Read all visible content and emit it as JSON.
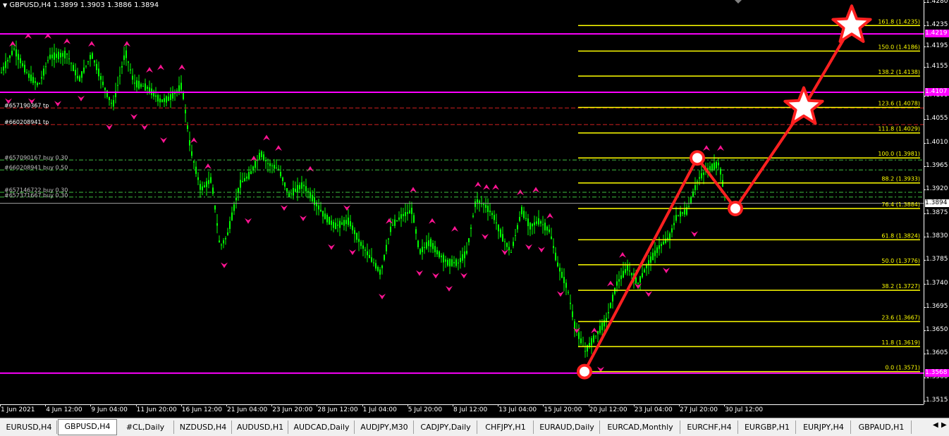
{
  "header": {
    "symbol_timeframe": "GBPUSD,H4",
    "ohlc": "1.3899 1.3903 1.3886 1.3894"
  },
  "price_axis": {
    "labels": [
      "1.4280",
      "1.4235",
      "1.4195",
      "1.4155",
      "1.4100",
      "1.4055",
      "1.4010",
      "1.3965",
      "1.3920",
      "1.3875",
      "1.3830",
      "1.3785",
      "1.3740",
      "1.3695",
      "1.3650",
      "1.3605",
      "1.3560",
      "1.3515"
    ],
    "highlights": [
      {
        "text": "1.4219",
        "color": "#ff00ff"
      },
      {
        "text": "1.4107",
        "color": "#ff00ff"
      },
      {
        "text": "1.3894",
        "color": "#ffffff"
      },
      {
        "text": "1.3568",
        "color": "#ff00ff"
      }
    ]
  },
  "time_axis": {
    "labels": [
      "1 Jun 2021",
      "4 Jun 12:00",
      "9 Jun 04:00",
      "11 Jun 20:00",
      "16 Jun 12:00",
      "21 Jun 04:00",
      "23 Jun 20:00",
      "28 Jun 12:00",
      "1 Jul 04:00",
      "5 Jul 20:00",
      "8 Jul 12:00",
      "13 Jul 04:00",
      "15 Jul 20:00",
      "20 Jul 12:00",
      "23 Jul 04:00",
      "27 Jul 20:00",
      "30 Jul 12:00"
    ]
  },
  "fib_levels": [
    {
      "label": "161.8 (1.4235)",
      "price": 1.4235
    },
    {
      "label": "150.0 (1.4186)",
      "price": 1.4186
    },
    {
      "label": "138.2 (1.4138)",
      "price": 1.4138
    },
    {
      "label": "123.6 (1.4078)",
      "price": 1.4078
    },
    {
      "label": "111.8 (1.4029)",
      "price": 1.4029
    },
    {
      "label": "100.0 (1.3981)",
      "price": 1.3981
    },
    {
      "label": "88.2 (1.3933)",
      "price": 1.3933
    },
    {
      "label": "76.4 (1.3884)",
      "price": 1.3884
    },
    {
      "label": "61.8 (1.3824)",
      "price": 1.3824
    },
    {
      "label": "50.0 (1.3776)",
      "price": 1.3776
    },
    {
      "label": "38.2 (1.3727)",
      "price": 1.3727
    },
    {
      "label": "23.6 (1.3667)",
      "price": 1.3667
    },
    {
      "label": "11.8 (1.3619)",
      "price": 1.3619
    },
    {
      "label": "0.0 (1.3571)",
      "price": 1.3571
    }
  ],
  "order_labels": [
    {
      "text": "#657190367 tp",
      "color": "#ffffff"
    },
    {
      "text": "#660208941 tp",
      "color": "#ffffff"
    },
    {
      "text": "#657090167 buy 0.30",
      "color": "#c0c0c0"
    },
    {
      "text": "#660208941 buy 0.50",
      "color": "#c0c0c0"
    },
    {
      "text": "#657146722 buy 0.30",
      "color": "#c0c0c0"
    },
    {
      "text": "#657371667 buy 0.30",
      "color": "#c0c0c0"
    }
  ],
  "horizontal_lines": [
    {
      "price": 1.4219,
      "color": "#ff00ff",
      "style": "solid"
    },
    {
      "price": 1.4107,
      "color": "#ff00ff",
      "style": "solid"
    },
    {
      "price": 1.3568,
      "color": "#ff00ff",
      "style": "solid"
    }
  ],
  "tabs": [
    "EURUSD,H4",
    "GBPUSD,H4",
    "#CL,Daily",
    "NZDUSD,H4",
    "AUDUSD,H1",
    "AUDCAD,Daily",
    "AUDJPY,M30",
    "CADJPY,Daily",
    "CHFJPY,H1",
    "EURAUD,Daily",
    "EURCAD,Monthly",
    "EURCHF,H4",
    "EURGBP,H1",
    "EURJPY,H4",
    "GBPAUD,H1"
  ],
  "active_tab": "GBPUSD,H4",
  "colors": {
    "background": "#000000",
    "candle": "#00ff00",
    "fib": "#ffff00",
    "resistance": "#ff00ff",
    "projection": "#ff2020",
    "fractal": "#ff1493"
  }
}
